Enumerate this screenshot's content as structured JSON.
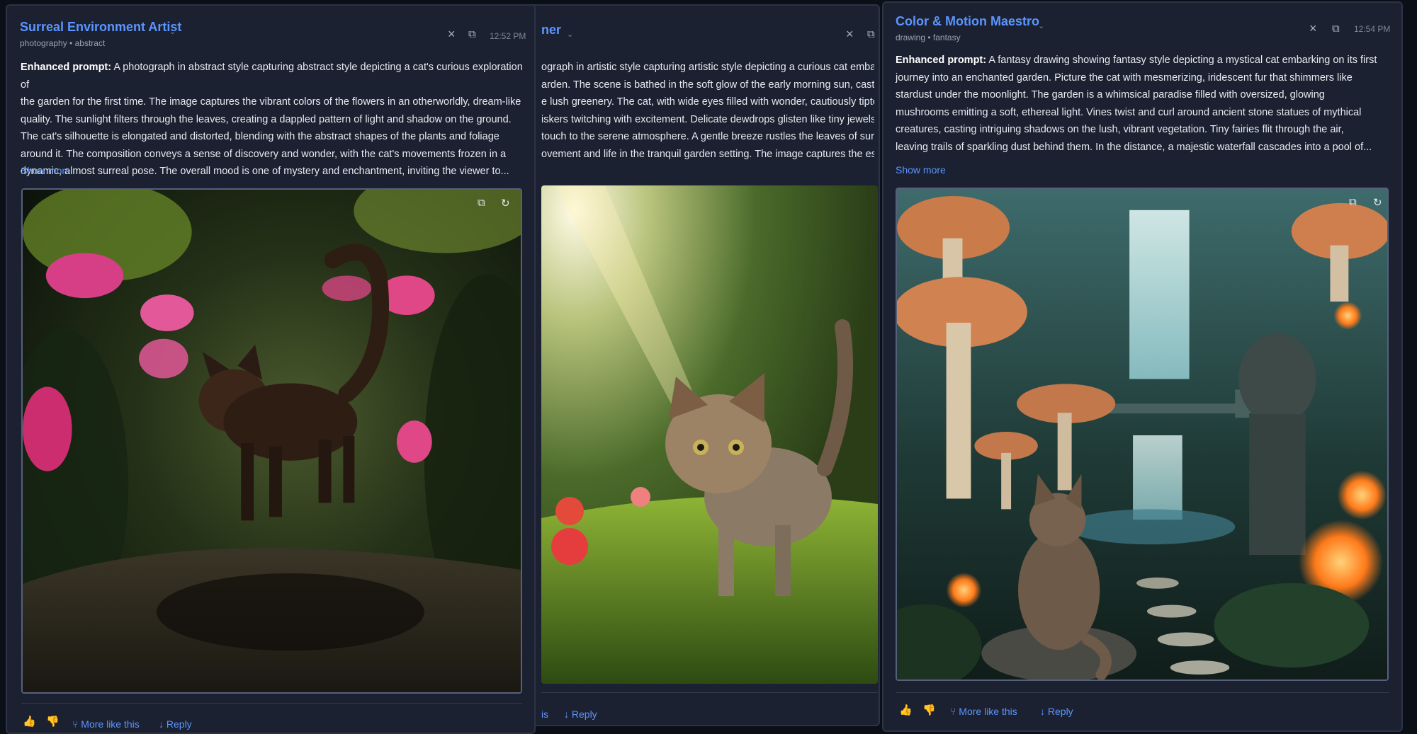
{
  "panels": [
    {
      "title": "Surreal Environment Artist",
      "tags": "photography • abstract",
      "time": "12:52 PM",
      "prompt_label": "Enhanced prompt:",
      "prompt_lines": [
        " A photograph in abstract style capturing abstract style depicting a cat's curious exploration of",
        "the garden for the first time. The image captures the vibrant colors of the flowers in an otherworldly, dream-like",
        "quality. The sunlight filters through the leaves, creating a dappled pattern of light and shadow on the ground.",
        "The cat's silhouette is elongated and distorted, blending with the abstract shapes of the plants and foliage",
        "around it. The composition conveys a sense of discovery and wonder, with the cat's movements frozen in a",
        "dynamic, almost surreal pose. The overall mood is one of mystery and enchantment, inviting the viewer to..."
      ],
      "show_more": "Show more",
      "more_like_this": "More like this",
      "reply": "Reply"
    },
    {
      "title": "ner",
      "prompt_lines": [
        "ograph in artistic style capturing artistic style depicting a curious cat embarki",
        "arden. The scene is bathed in the soft glow of the early morning sun, casting",
        "e lush greenery. The cat, with wide eyes filled with wonder, cautiously tiptoe",
        "iskers twitching with excitement. Delicate dewdrops glisten like tiny jewels o",
        "touch to the serene atmosphere. A gentle breeze rustles the leaves of surrou",
        "ovement and life in the tranquil garden setting. The image captures the ess"
      ],
      "more_like_this": "is",
      "reply": "Reply"
    },
    {
      "title": "Color & Motion Maestro",
      "tags": "drawing • fantasy",
      "time": "12:54 PM",
      "prompt_label": "Enhanced prompt:",
      "prompt_lines": [
        " A fantasy drawing showing fantasy style depicting a mystical cat embarking on its first",
        "journey into an enchanted garden. Picture the cat with mesmerizing, iridescent fur that shimmers like",
        "stardust under the moonlight. The garden is a whimsical paradise filled with oversized, glowing",
        "mushrooms emitting a soft, ethereal light. Vines twist and curl around ancient stone statues of mythical",
        "creatures, casting intriguing shadows on the lush, vibrant vegetation. Tiny fairies flit through the air,",
        "leaving trails of sparkling dust behind them. In the distance, a majestic waterfall cascades into a pool of..."
      ],
      "show_more": "Show more",
      "more_like_this": "More like this",
      "reply": "Reply"
    }
  ],
  "icons": {
    "close": "×",
    "copy": "⧉",
    "chevron": "⌄",
    "refresh": "↻",
    "thumbs_up": "👍",
    "thumbs_down": "👎",
    "branch": "⑂",
    "reply_arrow": "↓"
  },
  "colors": {
    "panel_bg": "#1b2130",
    "accent": "#5b95ff",
    "page_bg": "#0b0f17"
  }
}
